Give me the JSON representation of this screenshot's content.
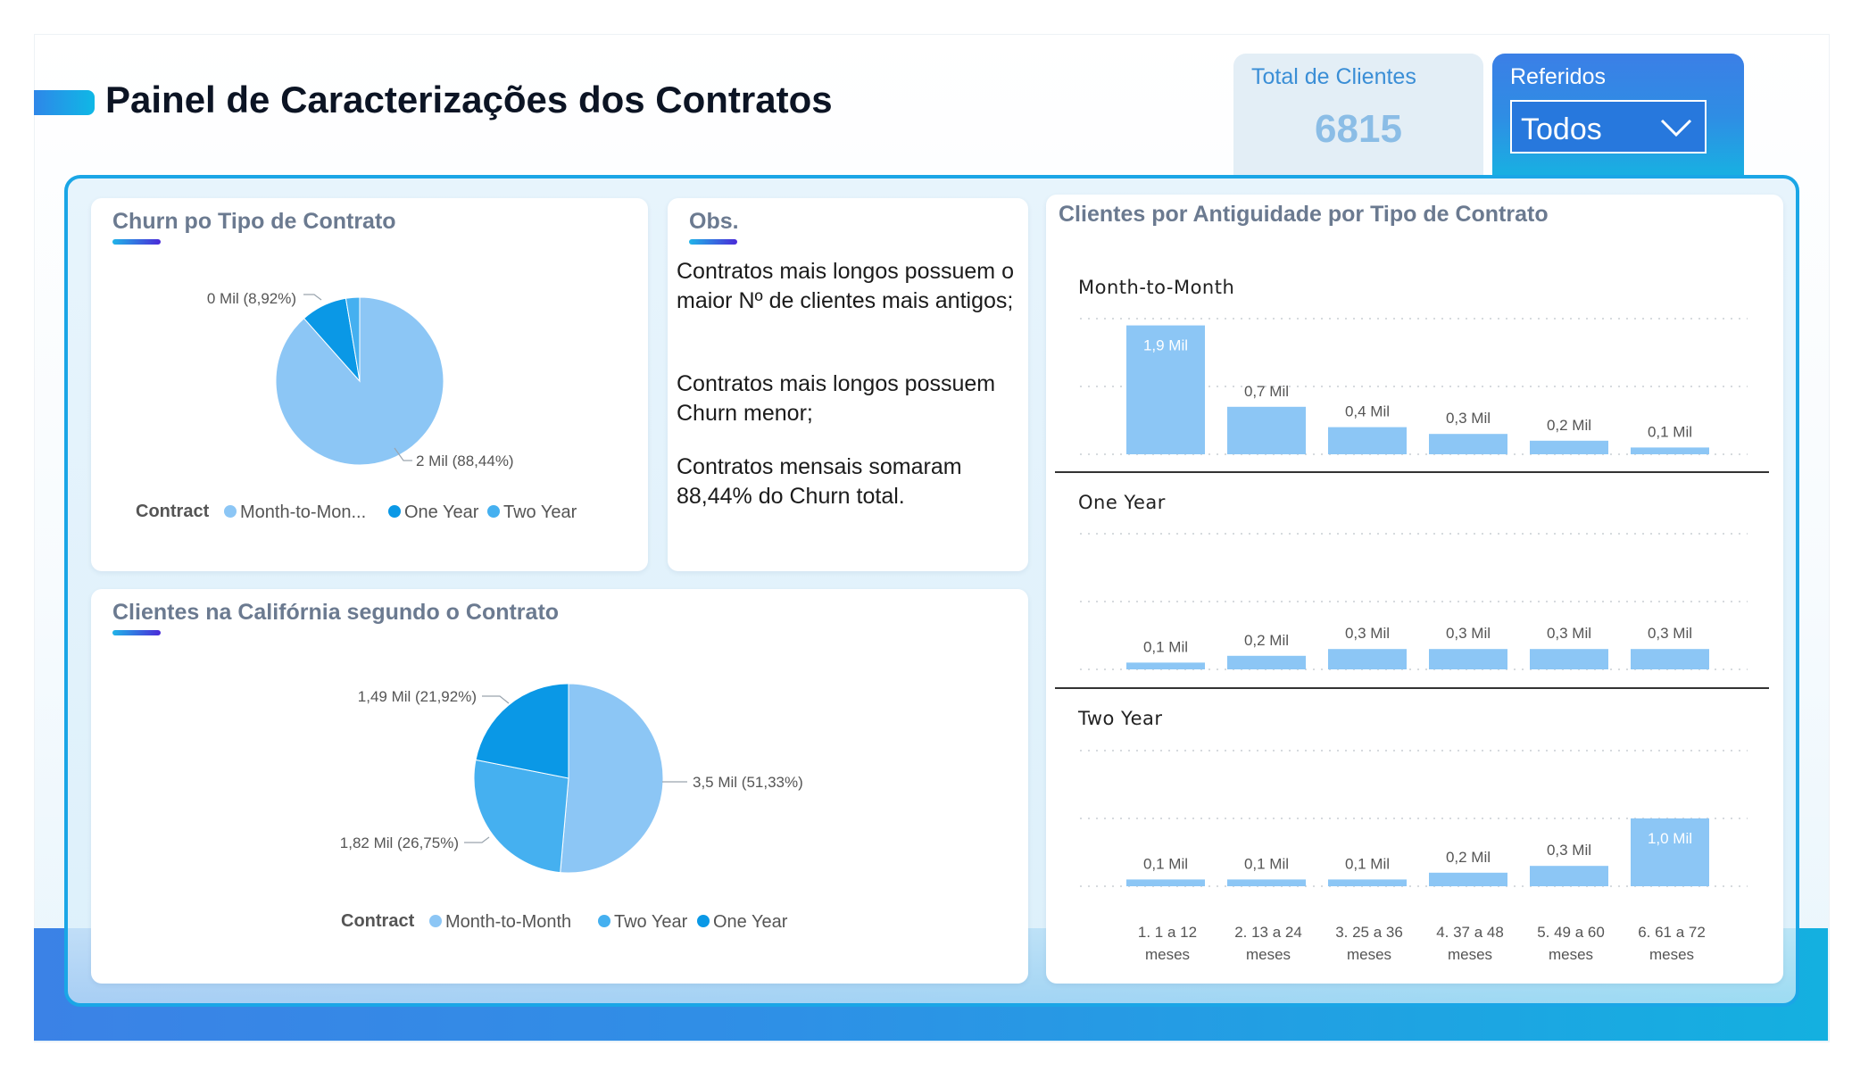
{
  "page": {
    "title": "Painel de Caracterizações dos Contratos"
  },
  "kpi": {
    "label": "Total de Clientes",
    "value": "6815"
  },
  "filter": {
    "label": "Referidos",
    "selected": "Todos"
  },
  "churn_card": {
    "title": "Churn po Tipo de Contrato",
    "legend_title": "Contract",
    "legend_items": [
      "Month-to-Mon...",
      "One Year",
      "Two Year"
    ],
    "labels": [
      "0 Mil (8,92%)",
      "2 Mil (88,44%)"
    ]
  },
  "obs_card": {
    "title": "Obs.",
    "paragraphs": [
      "Contratos mais longos possuem o maior Nº de clientes mais antigos;",
      "Contratos mais longos possuem Churn menor;",
      "Contratos mensais somaram 88,44% do Churn total."
    ]
  },
  "california_card": {
    "title": "Clientes na Califórnia segundo o Contrato",
    "legend_title": "Contract",
    "legend_items": [
      "Month-to-Month",
      "Two Year",
      "One Year"
    ],
    "labels": [
      "1,49 Mil (21,92%)",
      "3,5 Mil (51,33%)",
      "1,82 Mil (26,75%)"
    ]
  },
  "tenure_card": {
    "title": "Clientes por Antiguidade por Tipo de Contrato",
    "panels": [
      "Month-to-Month",
      "One Year",
      "Two Year"
    ],
    "categories": [
      [
        "1. 1 a 12",
        "meses"
      ],
      [
        "2. 13 a 24",
        "meses"
      ],
      [
        "3. 25 a 36",
        "meses"
      ],
      [
        "4. 37 a 48",
        "meses"
      ],
      [
        "5. 49 a 60",
        "meses"
      ],
      [
        "6. 61 a 72",
        "meses"
      ]
    ],
    "bar_labels": [
      [
        "1,9 Mil",
        "0,7 Mil",
        "0,4 Mil",
        "0,3 Mil",
        "0,2 Mil",
        "0,1 Mil"
      ],
      [
        "0,1 Mil",
        "0,2 Mil",
        "0,3 Mil",
        "0,3 Mil",
        "0,3 Mil",
        "0,3 Mil"
      ],
      [
        "0,1 Mil",
        "0,1 Mil",
        "0,1 Mil",
        "0,2 Mil",
        "0,3 Mil",
        "1,0 Mil"
      ]
    ]
  },
  "colors": {
    "month_to_month": "#8cc6f5",
    "one_year": "#0a98e6",
    "two_year": "#45b0f0",
    "bar": "#8cc6f5",
    "accent": "#1aa6e6"
  },
  "chart_data": [
    {
      "type": "pie",
      "title": "Churn po Tipo de Contrato",
      "legend_title": "Contract",
      "labels": [
        "Month-to-Month",
        "One Year",
        "Two Year"
      ],
      "values": [
        88.44,
        8.92,
        2.64
      ],
      "unit": "%"
    },
    {
      "type": "pie",
      "title": "Clientes na Califórnia segundo o Contrato",
      "legend_title": "Contract",
      "labels": [
        "Month-to-Month",
        "Two Year",
        "One Year"
      ],
      "values": [
        3.5,
        1.82,
        1.49
      ],
      "percentages": [
        51.33,
        26.75,
        21.92
      ],
      "unit": "Mil"
    },
    {
      "type": "bar",
      "title": "Clientes por Antiguidade por Tipo de Contrato",
      "categories": [
        "1. 1 a 12 meses",
        "2. 13 a 24 meses",
        "3. 25 a 36 meses",
        "4. 37 a 48 meses",
        "5. 49 a 60 meses",
        "6. 61 a 72 meses"
      ],
      "series": [
        {
          "name": "Month-to-Month",
          "values": [
            1.9,
            0.7,
            0.4,
            0.3,
            0.2,
            0.1
          ]
        },
        {
          "name": "One Year",
          "values": [
            0.1,
            0.2,
            0.3,
            0.3,
            0.3,
            0.3
          ]
        },
        {
          "name": "Two Year",
          "values": [
            0.1,
            0.1,
            0.1,
            0.2,
            0.3,
            1.0
          ]
        }
      ],
      "unit": "Mil",
      "ylim": [
        0,
        1.9
      ]
    }
  ]
}
